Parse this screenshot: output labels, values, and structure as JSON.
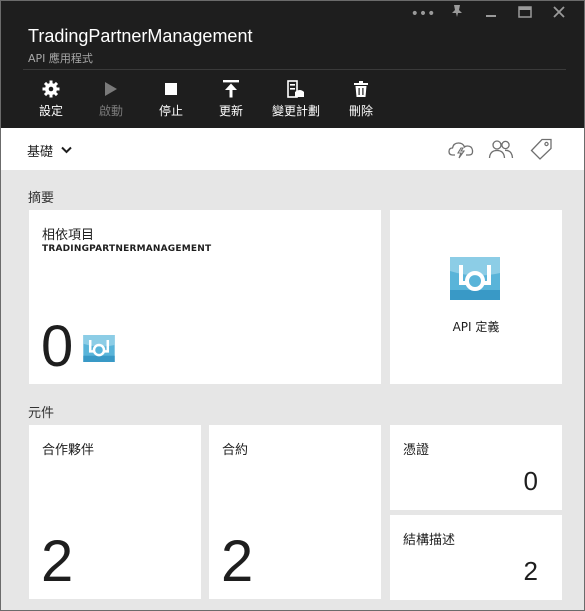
{
  "window": {
    "title": "TradingPartnerManagement",
    "subtitle": "API 應用程式",
    "controls": [
      "more-icon",
      "pin-icon",
      "minimize-icon",
      "maximize-icon",
      "close-icon"
    ]
  },
  "toolbar": {
    "settings": "設定",
    "start": "啟動",
    "stop": "停止",
    "refresh": "更新",
    "change_plan": "變更計劃",
    "delete": "刪除"
  },
  "cmdbar": {
    "essentials": "基礎",
    "icons": [
      "cloud-lightning-icon",
      "users-icon",
      "tag-icon"
    ]
  },
  "summary": {
    "label": "摘要",
    "dependencies": {
      "title": "相依項目",
      "subtitle": "TRADINGPARTNERMANAGEMENT",
      "count": "0"
    },
    "api_definition": {
      "label": "API 定義"
    }
  },
  "components": {
    "label": "元件",
    "partners": {
      "title": "合作夥伴",
      "count": "2"
    },
    "agreements": {
      "title": "合約",
      "count": "2"
    },
    "certificates": {
      "title": "憑證",
      "count": "0"
    },
    "schemas": {
      "title": "結構描述",
      "count": "2"
    }
  },
  "colors": {
    "header_bg": "#1e1e1e",
    "content_bg": "#e6e6e6",
    "api_icon_blue": "#59b4d9"
  }
}
